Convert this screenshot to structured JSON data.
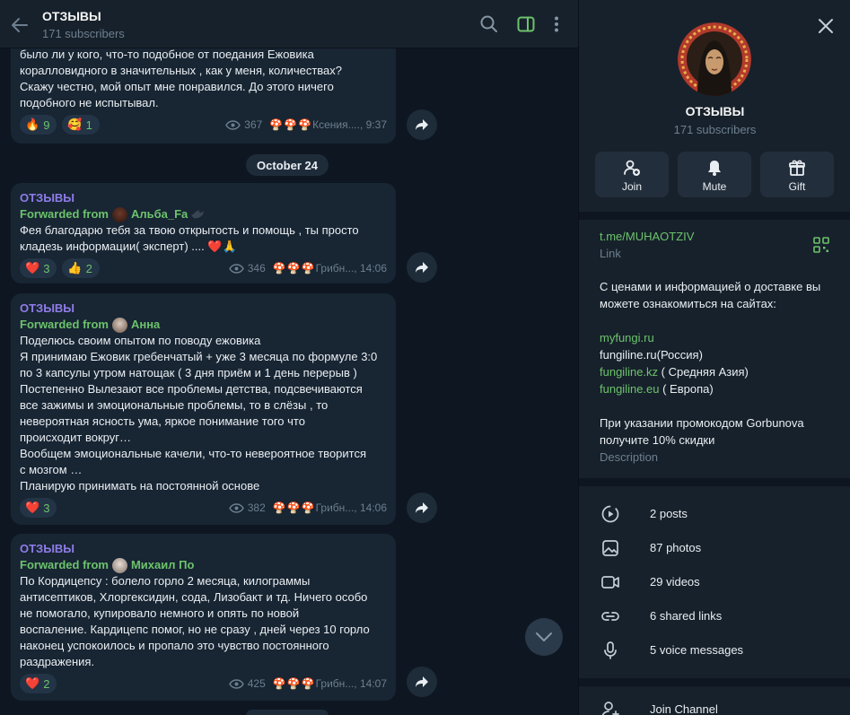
{
  "header": {
    "title": "ОТЗЫВЫ",
    "subscribers": "171 subscribers"
  },
  "top_message": {
    "text": "было ли у кого, что-то подобное от поедания Ежовика\nкоралловидного в значительных , как у меня, количествах?\nСкажу честно, мой опыт мне понравился. До этого ничего\nподобного не испытывал.",
    "reactions": [
      {
        "emoji": "🔥",
        "count": "9"
      },
      {
        "emoji": "🥰",
        "count": "1"
      }
    ],
    "views": "367",
    "signature": "Ксения...., 9:37"
  },
  "date_separator": "October 24",
  "messages": [
    {
      "channel": "ОТЗЫВЫ",
      "forwarded_label": "Forwarded from",
      "forwarded_name": "Альба_Fa",
      "text": "Фея благодарю тебя за твою открытость и помощь , ты просто\nкладезь информации( эксперт) .... ❤️🙏",
      "reactions": [
        {
          "emoji": "❤️",
          "count": "3"
        },
        {
          "emoji": "👍",
          "count": "2"
        }
      ],
      "views": "346",
      "signature": "Грибн..., 14:06"
    },
    {
      "channel": "ОТЗЫВЫ",
      "forwarded_label": "Forwarded from",
      "forwarded_name": "Анна",
      "text": "Поделюсь своим опытом по поводу ежовика\nЯ принимаю Ежовик гребенчатый + уже 3 месяца по формуле 3:0\nпо 3 капсулы утром натощак ( 3 дня приём и 1 день перерыв )\nПостепенно Вылезают все проблемы детства, подсвечиваются\nвсе зажимы и эмоциональные проблемы, то в слёзы , то\nневероятная ясность ума, яркое понимание того что\nпроисходит вокруг…\nВообщем эмоциональные качели, что-то невероятное творится\nс мозгом …\nПланирую принимать на постоянной основе",
      "reactions": [
        {
          "emoji": "❤️",
          "count": "3"
        }
      ],
      "views": "382",
      "signature": "Грибн..., 14:06"
    },
    {
      "channel": "ОТЗЫВЫ",
      "forwarded_label": "Forwarded from",
      "forwarded_name": "Михаил По",
      "text": "По Кордицепсу : болело горло 2 месяца, килограммы\nантисептиков, Хлоргексидин, сода, Лизобакт и тд. Ничего особо\nне помогало, купировало немного и опять по новой\nвоспаление. Кардицепс помог, но не сразу , дней через 10 горло\nнаконец успокоилось и пропало это чувство постоянного\nраздражения.",
      "reactions": [
        {
          "emoji": "❤️",
          "count": "2"
        }
      ],
      "views": "425",
      "signature": "Грибн..., 14:07"
    }
  ],
  "mushroom_glyphs": "🍄🍄🍄",
  "profile": {
    "title": "ОТЗЫВЫ",
    "subscribers": "171 subscribers",
    "actions": [
      {
        "label": "Join",
        "icon": "add-user-icon"
      },
      {
        "label": "Mute",
        "icon": "bell-icon"
      },
      {
        "label": "Gift",
        "icon": "gift-icon"
      }
    ],
    "link": "t.me/MUHAOTZIV",
    "link_caption": "Link",
    "description_lines": {
      "intro": "С ценами и информацией о доставке вы можете ознакомиться на сайтах:",
      "site1": "myfungi.ru",
      "site2_name": "fungiline.ru",
      "site2_suffix": "(Россия)",
      "site3_name": "fungiline.kz",
      "site3_suffix": " ( Средняя Азия)",
      "site4_name": "fungiline.eu",
      "site4_suffix": " ( Европа)",
      "promo": "При указании промокодом Gorbunova получите 10% скидки"
    },
    "description_caption": "Description",
    "media": [
      {
        "label": "2 posts",
        "icon": "posts-icon"
      },
      {
        "label": "87 photos",
        "icon": "photo-icon"
      },
      {
        "label": "29 videos",
        "icon": "video-icon"
      },
      {
        "label": "6 shared links",
        "icon": "link-icon"
      },
      {
        "label": "5 voice messages",
        "icon": "mic-icon"
      }
    ],
    "join_channel": "Join Channel"
  },
  "colors": {
    "accent_green": "#6cc36c",
    "channel_purple": "#8e7ce8",
    "bubble_bg": "#182533",
    "chat_bg": "#0e1621",
    "panel_bg": "#17212b"
  }
}
